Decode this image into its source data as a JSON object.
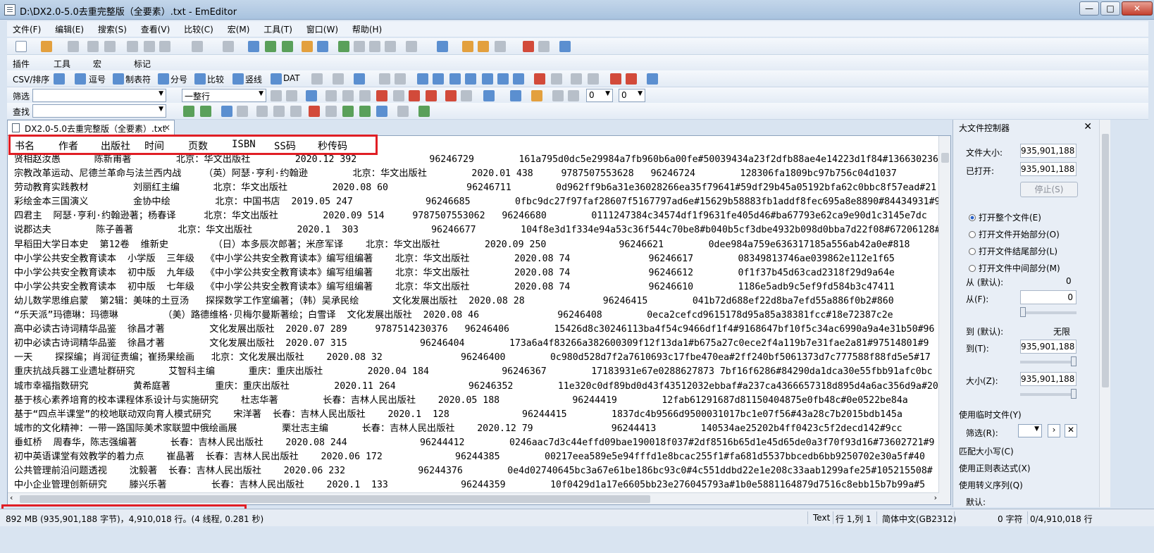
{
  "window": {
    "title": "D:\\DX2.0-5.0去重完整版（全要素）.txt - EmEditor",
    "minimize": "—",
    "maximize": "□",
    "close": "✕"
  },
  "menu": [
    "文件(F)",
    "编辑(E)",
    "搜索(S)",
    "查看(V)",
    "比较(C)",
    "宏(M)",
    "工具(T)",
    "窗口(W)",
    "帮助(H)"
  ],
  "toolbar2": {
    "plugin": "插件",
    "tools": "工具",
    "macro": "宏",
    "marker": "标记"
  },
  "toolbar3": {
    "csv": "CSV/排序",
    "comma": "逗号",
    "tab": "制表符",
    "semicolon": "分号",
    "compare": "比较",
    "pipe": "竖线",
    "dat": "DAT"
  },
  "filter_bar": {
    "label": "筛选",
    "input_value": "",
    "mode": "一整行",
    "num1": "0",
    "num2": "0"
  },
  "find_bar": {
    "label": "查找",
    "input_value": ""
  },
  "tab": {
    "label": "DX2.0-5.0去重完整版（全要素）.txt",
    "close": "×"
  },
  "table": {
    "headers": [
      "书名",
      "作者",
      "出版社",
      "时间",
      "页数",
      "ISBN",
      "SS码",
      "秒传码"
    ],
    "rows": [
      "贤相赵汝愚      陈新甫著        北京：华文出版社        2020.12 392             96246729        161a795d0dc5e29984a7fb960b6a00fe#50039434a23f2dfb88ae4e14223d1f84#136630236#",
      "宗教改革运动、尼德兰革命与法兰西内战    （英）阿瑟·亨利·约翰逊        北京：华文出版社        2020.01 438     9787507553628   96246724        128306fa1809bc97b756c04d1037",
      "劳动教育实践教材        刘丽红主编      北京：华文出版社        2020.08 60              96246711        0d962ff9b6a31e36028266ea35f79641#59df29b45a05192bfa62c0bbc8f57ead#21",
      "彩绘金本三国演义        金协中绘        北京：中国书店  2019.05 247             96246685        0fbc9dc27f97faf28607f5167797ad6e#15629b58883fb1addf8fec695a8e8890#84434931#9",
      "四君主  阿瑟·亨利·约翰逊著；杨春译     北京：华文出版社        2020.09 514     9787507553062   96246680        0111247384c34574df1f9631fe405d46#ba67793e62ca9e90d1c3145e7dc",
      "说郡达夫        陈子善著        北京：华文出版社        2020.1  303             96246677        104f8e3d1f334e94a53c36f544c70be8#b040b5cf3dbe4932b098d0bba7d22f08#67206128#9",
      "早稻田大学日本史  第12卷  维新史        （日）本多辰次郎著；米彦军译    北京：华文出版社        2020.09 250             96246621        0dee984a759e636317185a556ab42a0e#818",
      "中小学公共安全教育读本  小学版  三年级  《中小学公共安全教育读本》编写组编著    北京：华文出版社        2020.08 74              96246617        08349813746ae039862e112e1f65",
      "中小学公共安全教育读本  初中版  九年级  《中小学公共安全教育读本》编写组编著    北京：华文出版社        2020.08 74              96246612        0f1f37b45d63cad2318f29d9a64e",
      "中小学公共安全教育读本  初中版  七年级  《中小学公共安全教育读本》编写组编著    北京：华文出版社        2020.08 74              96246610        1186e5adb9c5ef9fd584b3c47411",
      "幼儿数学思维启蒙  第2辑：美味的土豆汤   探探数学工作室编著；（韩）吴承民绘      文化发展出版社  2020.08 28              96246415        041b72d688ef22d8ba7efd55a886f0b2#860",
      "“乐天派”玛德琳：玛德琳        （美）路德维格·贝梅尔曼斯著绘；白雪译  文化发展出版社  2020.08 46              96246408        0eca2cefcd9615178d95a85a38381fcc#18e72387c2e",
      "高中必读古诗词精华品鉴  徐昌才著        文化发展出版社  2020.07 289     9787514230376   96246406        15426d8c30246113ba4f54c9466df1f4#9168647bf10f5c34ac6990a9a4e31b50#96",
      "初中必读古诗词精华品鉴  徐昌才著        文化发展出版社  2020.07 315             96246404        173a6a4f83266a382600309f12f13da1#b675a27c0ece2f4a119b7e31fae2a81#97514801#9",
      "一天    探探编；肖润征责编；崔扬果绘画   北京：文化发展出版社    2020.08 32              96246400        0c980d528d7f2a7610693c17fbe470ea#2ff240bf5061373d7c777588f88fd5e5#17",
      "重庆抗战兵器工业遗址群研究      艾智科主编      重庆：重庆出版社        2020.04 184             96246367        17183931e67e0288627873 7bf16f6286#84290da1dca30e55fbb91afc0bc",
      "城市幸福指数研究        黄希庭著        重庆：重庆出版社        2020.11 264             96246352        11e320c0df89bd0d43f43512032ebbaf#a237ca4366657318d895d4a6ac356d9a#20",
      "基于核心素养培育的校本课程体系设计与实施研究    杜志华著        长春：吉林人民出版社    2020.05 188             96244419        12fab61291687d81150404875e0fb48c#0e0522be84a",
      "基于“四点半课堂”的校地联动双向育人模式研究    宋洋著  长春：吉林人民出版社    2020.1  128             96244415        1837dc4b9566d9500031017bc1e07f56#43a28c7b2015bdb145a",
      "城市的文化精神：一带一路国际美术家联盟中俄绘画展        栗壮志主编      长春：吉林人民出版社    2020.12 79              96244413        140534ae25202b4ff0423c5f2decd142#9cc",
      "垂虹桥  周春华，陈志强编著      长春：吉林人民出版社    2020.08 244             96244412        0246aac7d3c44effd09bae190018f037#2df8516b65d1e45d65de0a3f70f93d16#73602721#9",
      "初中英语课堂有效教学的着力点    崔晶著  长春：吉林人民出版社    2020.06 172             96244385        00217eea589e5e94fffd1e8bcac255f1#fa681d5537bbcedb6bb9250702e30a5f#40",
      "公共管理前沿问题透视    沈毅著  长春：吉林人民出版社    2020.06 232             96244376        0e4d02740645bc3a67e61be186bc93c0#4c551ddbd22e1e208c33aab1299afe25#105215508#",
      "中小企业管理创新研究    滕兴乐著        长春：吉林人民出版社    2020.1  133             96244359        10f0429d1a17e6605bb23e276045793a#1b0e5881164879d7516c8ebb15b7b99a#5"
    ]
  },
  "panel": {
    "title": "大文件控制器",
    "file_size_label": "文件大小:",
    "file_size": "935,901,188",
    "opened_label": "已打开:",
    "opened": "935,901,188",
    "stop_button": "停止(S)",
    "radio_options": [
      "打开整个文件(E)",
      "打开文件开始部分(O)",
      "打开文件结尾部分(L)",
      "打开文件中间部分(M)"
    ],
    "from_default_label": "从 (默认):",
    "from_default": "0",
    "from_label": "从(F):",
    "from_value": "0",
    "to_default_label": "到 (默认):",
    "to_default": "无限",
    "to_label": "到(T):",
    "to_value": "935,901,188",
    "size_label": "大小(Z):",
    "size_value": "935,901,188",
    "use_temp_label": "使用临时文件(Y)",
    "filter_label": "筛选(R):",
    "match_case": "匹配大小写(C)",
    "use_regex": "使用正则表达式(X)",
    "use_escape": "使用转义序列(Q)",
    "default_label": "默认:"
  },
  "status": {
    "summary": "892 MB (935,901,188 字节)，4,910,018 行。(4 线程, 0.281 秒)",
    "mode": "Text",
    "position": "行 1,列 1",
    "encoding": "简体中文(GB2312)",
    "chars": "0 字符",
    "lines": "0/4,910,018 行"
  },
  "colors": {
    "highlight_border": "#e01e25",
    "window_bg": "#d9e4f1"
  }
}
